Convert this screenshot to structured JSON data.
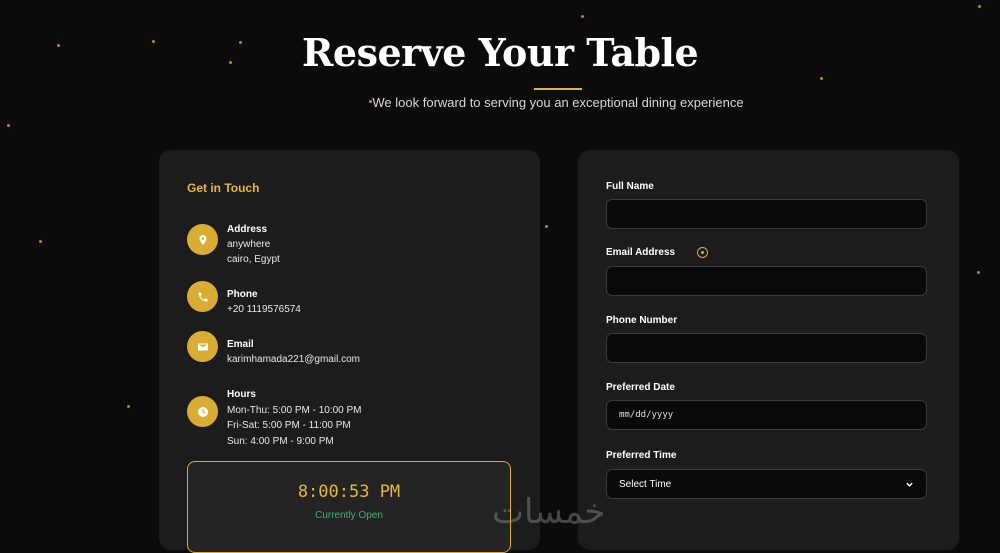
{
  "hero": {
    "title": "Reserve Your Table",
    "subtitle": "We look forward to serving you an exceptional dining experience"
  },
  "contact": {
    "title": "Get in Touch",
    "address": {
      "label": "Address",
      "line1": "anywhere",
      "line2": "cairo, Egypt",
      "icon": "location-pin-icon"
    },
    "phone": {
      "label": "Phone",
      "value": "+20 1119576574",
      "icon": "phone-icon"
    },
    "email": {
      "label": "Email",
      "value": "karimhamada221@gmail.com",
      "icon": "envelope-icon"
    },
    "hours": {
      "label": "Hours",
      "line1": "Mon-Thu: 5:00 PM - 10:00 PM",
      "line2": "Fri-Sat: 5:00 PM - 11:00 PM",
      "line3": "Sun: 4:00 PM - 9:00 PM",
      "icon": "clock-icon"
    },
    "clock": {
      "time": "8:00:53 PM",
      "status": "Currently Open"
    }
  },
  "form": {
    "full_name_label": "Full Name",
    "email_label": "Email Address",
    "phone_label": "Phone Number",
    "date_label": "Preferred Date",
    "date_placeholder": "mm/dd/yyyy",
    "time_label": "Preferred Time",
    "time_selected": "Select Time"
  },
  "watermark": "خمسات",
  "colors": {
    "accent": "#e0b53a",
    "background": "#0b0b0b",
    "card": "#1c1c1c",
    "open_status": "#3bb36a"
  }
}
